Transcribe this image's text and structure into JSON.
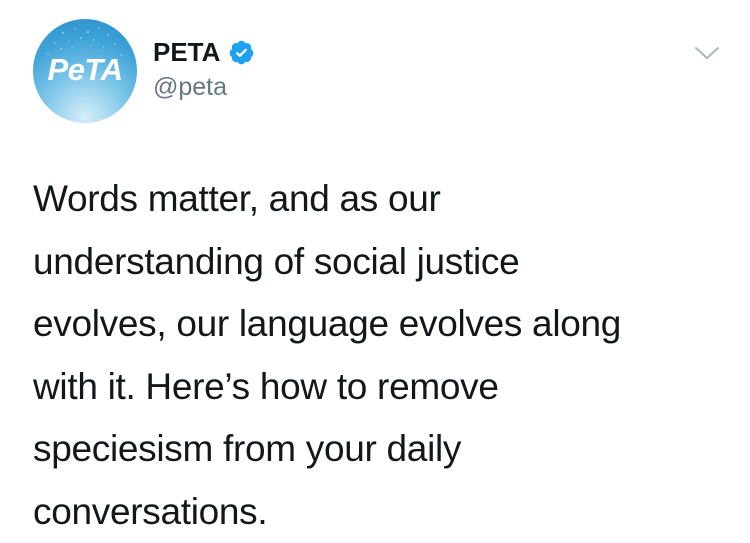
{
  "author": {
    "avatar_text": "PeTA",
    "display_name": "PETA",
    "handle": "@peta",
    "verified_icon": "verified-badge-icon"
  },
  "menu": {
    "icon": "chevron-down-icon"
  },
  "tweet": {
    "text": "Words matter, and as our\nunderstanding of social justice\nevolves, our language evolves along\nwith it. Here’s how to remove\nspeciesism from your daily\nconversations."
  },
  "colors": {
    "verified_blue": "#1da1f2",
    "handle_gray": "#657786",
    "text_dark": "#14171a",
    "avatar_blue": "#3fa3d8"
  }
}
